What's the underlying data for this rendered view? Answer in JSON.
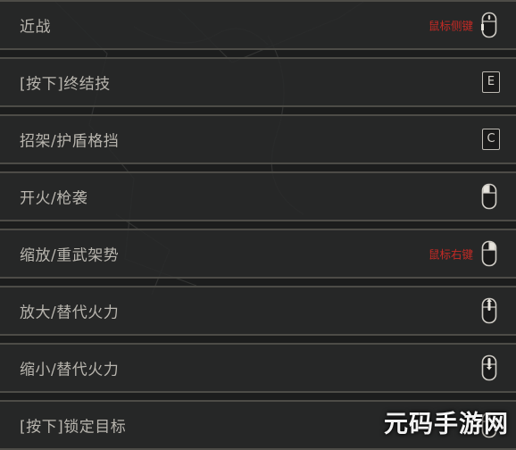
{
  "rows": [
    {
      "label": "近战",
      "binding": "鼠标侧键",
      "icon": "mouse-side-button-icon"
    },
    {
      "label": "[按下]终结技",
      "key": "E",
      "icon": "keycap-e-icon"
    },
    {
      "label": "招架/护盾格挡",
      "key": "C",
      "icon": "keycap-c-icon"
    },
    {
      "label": "开火/枪袭",
      "icon": "mouse-left-button-icon"
    },
    {
      "label": "缩放/重武架势",
      "binding": "鼠标右键",
      "icon": "mouse-right-button-icon"
    },
    {
      "label": "放大/替代火力",
      "icon": "mouse-wheel-up-icon"
    },
    {
      "label": "缩小/替代火力",
      "icon": "mouse-wheel-down-icon"
    },
    {
      "label": "[按下]锁定目标",
      "icon": "mouse-wheel-click-icon"
    }
  ],
  "watermark": {
    "text": "元码手游网"
  },
  "colors": {
    "row_bg": "#282929",
    "row_border": "#4d4c47",
    "label_text": "#b8b5ae",
    "binding_text": "#c42a25"
  }
}
